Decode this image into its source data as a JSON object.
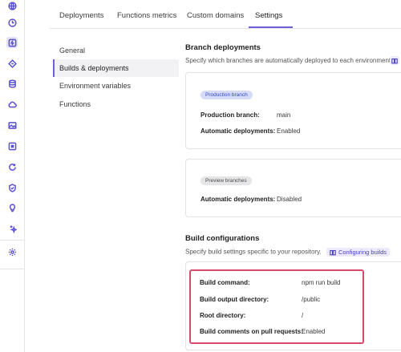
{
  "tabs": [
    {
      "label": "Deployments"
    },
    {
      "label": "Functions metrics"
    },
    {
      "label": "Custom domains"
    },
    {
      "label": "Settings"
    }
  ],
  "active_tab": "Settings",
  "settings_nav": [
    {
      "label": "General"
    },
    {
      "label": "Builds & deployments"
    },
    {
      "label": "Environment variables"
    },
    {
      "label": "Functions"
    }
  ],
  "active_nav": "Builds & deployments",
  "branch_deployments": {
    "title": "Branch deployments",
    "description": "Specify which branches are automatically deployed to each environment.",
    "production": {
      "badge": "Production branch",
      "branch_label": "Production branch:",
      "branch_value": "main",
      "auto_label": "Automatic deployments:",
      "auto_value": "Enabled"
    },
    "preview": {
      "badge": "Preview branches",
      "auto_label": "Automatic deployments:",
      "auto_value": "Disabled"
    }
  },
  "build_configurations": {
    "title": "Build configurations",
    "description": "Specify build settings specific to your repository.",
    "doc_link": "Configuring builds",
    "rows": [
      {
        "label": "Build command:",
        "value": "npm run build"
      },
      {
        "label": "Build output directory:",
        "value": "/public"
      },
      {
        "label": "Root directory:",
        "value": "/"
      },
      {
        "label": "Build comments on pull requests:",
        "value": "Enabled"
      }
    ]
  },
  "accent_color": "#6b62d9",
  "highlight_color": "#d64b6b",
  "rail_icons": [
    "globe-icon",
    "clock-icon",
    "bolt-icon",
    "diamond-icon",
    "database-icon",
    "cloud-icon",
    "image-icon",
    "chip-icon",
    "refresh-icon",
    "shield-icon",
    "lightbulb-icon",
    "sparkle-icon",
    "gear-icon"
  ]
}
